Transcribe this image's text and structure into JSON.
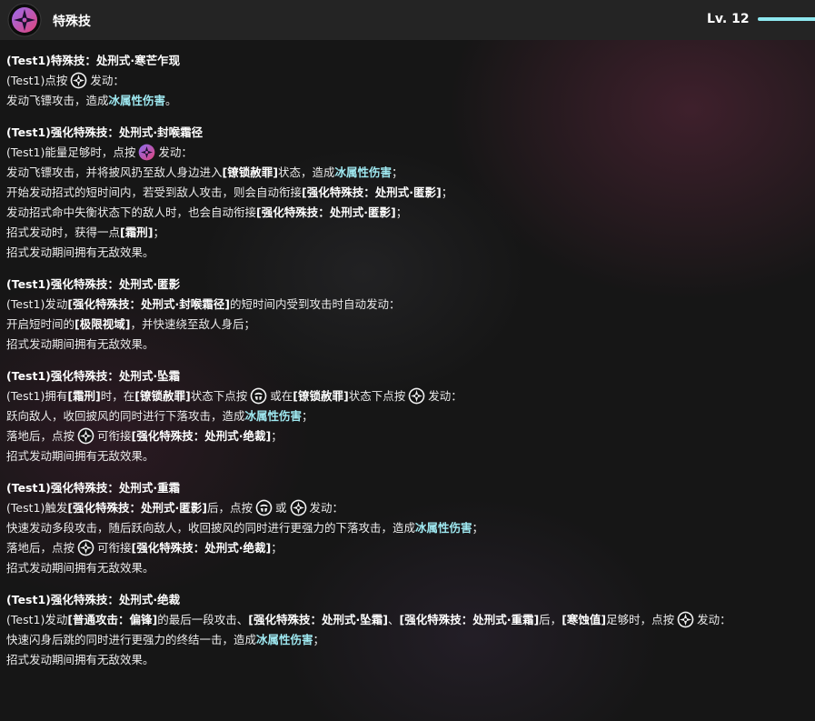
{
  "header": {
    "title": "特殊技",
    "level": "Lv. 12",
    "skill_icon": "special-attack-icon",
    "accent_color": "#8ee8f0"
  },
  "colors": {
    "ice": "#9fe9f1"
  },
  "sections": [
    {
      "title": "(Test1)特殊技：处刑式·寒芒乍现",
      "lines": [
        [
          {
            "t": "(Test1)点按"
          },
          {
            "icon": "special-button-icon"
          },
          {
            "t": "发动："
          }
        ],
        [
          {
            "t": "发动飞镖攻击，造成"
          },
          {
            "t": "冰属性伤害",
            "s": "ice"
          },
          {
            "t": "。"
          }
        ]
      ]
    },
    {
      "title": "(Test1)强化特殊技：处刑式·封喉霜径",
      "lines": [
        [
          {
            "t": "(Test1)能量足够时，点按"
          },
          {
            "icon": "ex-special-button-icon"
          },
          {
            "t": "发动："
          }
        ],
        [
          {
            "t": "发动飞镖攻击，并将披风扔至敌人身边进入"
          },
          {
            "t": "[镣锁赦罪]",
            "s": "b"
          },
          {
            "t": "状态，造成"
          },
          {
            "t": "冰属性伤害",
            "s": "ice"
          },
          {
            "t": "；"
          }
        ],
        [
          {
            "t": "开始发动招式的短时间内，若受到敌人攻击，则会自动衔接"
          },
          {
            "t": "[强化特殊技：处刑式·匿影]",
            "s": "b"
          },
          {
            "t": "；"
          }
        ],
        [
          {
            "t": "发动招式命中失衡状态下的敌人时，也会自动衔接"
          },
          {
            "t": "[强化特殊技：处刑式·匿影]",
            "s": "b"
          },
          {
            "t": "；"
          }
        ],
        [
          {
            "t": "招式发动时，获得一点"
          },
          {
            "t": "[霜刑]",
            "s": "b"
          },
          {
            "t": "；"
          }
        ],
        [
          {
            "t": "招式发动期间拥有无敌效果。"
          }
        ]
      ]
    },
    {
      "title": "(Test1)强化特殊技：处刑式·匿影",
      "lines": [
        [
          {
            "t": "(Test1)发动"
          },
          {
            "t": "[强化特殊技：处刑式·封喉霜径]",
            "s": "b"
          },
          {
            "t": "的短时间内受到攻击时自动发动："
          }
        ],
        [
          {
            "t": "开启短时间的"
          },
          {
            "t": "[极限视域]",
            "s": "b"
          },
          {
            "t": "，并快速绕至敌人身后；"
          }
        ],
        [
          {
            "t": "招式发动期间拥有无敌效果。"
          }
        ]
      ]
    },
    {
      "title": "(Test1)强化特殊技：处刑式·坠霜",
      "lines": [
        [
          {
            "t": "(Test1)拥有"
          },
          {
            "t": "[霜刑]",
            "s": "b"
          },
          {
            "t": "时，在"
          },
          {
            "t": "[镣锁赦罪]",
            "s": "b"
          },
          {
            "t": "状态下点按"
          },
          {
            "icon": "basic-attack-button-icon"
          },
          {
            "t": "或在"
          },
          {
            "t": "[镣锁赦罪]",
            "s": "b"
          },
          {
            "t": "状态下点按"
          },
          {
            "icon": "special-button-icon"
          },
          {
            "t": "发动："
          }
        ],
        [
          {
            "t": "跃向敌人，收回披风的同时进行下落攻击，造成"
          },
          {
            "t": "冰属性伤害",
            "s": "ice"
          },
          {
            "t": "；"
          }
        ],
        [
          {
            "t": "落地后，点按"
          },
          {
            "icon": "special-button-icon"
          },
          {
            "t": "可衔接"
          },
          {
            "t": "[强化特殊技：处刑式·绝裁]",
            "s": "b"
          },
          {
            "t": "；"
          }
        ],
        [
          {
            "t": "招式发动期间拥有无敌效果。"
          }
        ]
      ]
    },
    {
      "title": "(Test1)强化特殊技：处刑式·重霜",
      "lines": [
        [
          {
            "t": "(Test1)触发"
          },
          {
            "t": "[强化特殊技：处刑式·匿影]",
            "s": "b"
          },
          {
            "t": "后，点按"
          },
          {
            "icon": "basic-attack-button-icon"
          },
          {
            "t": "或"
          },
          {
            "icon": "special-button-icon"
          },
          {
            "t": "发动："
          }
        ],
        [
          {
            "t": "快速发动多段攻击，随后跃向敌人，收回披风的同时进行更强力的下落攻击，造成"
          },
          {
            "t": "冰属性伤害",
            "s": "ice"
          },
          {
            "t": "；"
          }
        ],
        [
          {
            "t": "落地后，点按"
          },
          {
            "icon": "special-button-icon"
          },
          {
            "t": "可衔接"
          },
          {
            "t": "[强化特殊技：处刑式·绝裁]",
            "s": "b"
          },
          {
            "t": "；"
          }
        ],
        [
          {
            "t": "招式发动期间拥有无敌效果。"
          }
        ]
      ]
    },
    {
      "title": "(Test1)强化特殊技：处刑式·绝裁",
      "lines": [
        [
          {
            "t": "(Test1)发动"
          },
          {
            "t": "[普通攻击：偏锋]",
            "s": "b"
          },
          {
            "t": "的最后一段攻击、"
          },
          {
            "t": "[强化特殊技：处刑式·坠霜]",
            "s": "b"
          },
          {
            "t": "、"
          },
          {
            "t": "[强化特殊技：处刑式·重霜]",
            "s": "b"
          },
          {
            "t": "后，"
          },
          {
            "t": "[寒蚀值]",
            "s": "b"
          },
          {
            "t": "足够时，点按"
          },
          {
            "icon": "special-button-icon"
          },
          {
            "t": "发动："
          }
        ],
        [
          {
            "t": "快速闪身后跳的同时进行更强力的终结一击，造成"
          },
          {
            "t": "冰属性伤害",
            "s": "ice"
          },
          {
            "t": "；"
          }
        ],
        [
          {
            "t": "招式发动期间拥有无敌效果。"
          }
        ]
      ]
    }
  ]
}
